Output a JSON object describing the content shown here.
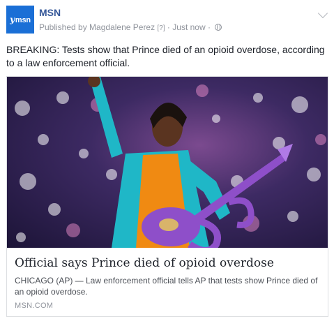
{
  "page": {
    "name": "MSN",
    "logo_text": "msn",
    "logo_mark": "y"
  },
  "meta": {
    "published_by": "Published by Magdalene Perez",
    "help": "[?]",
    "separator": "·",
    "time": "Just now",
    "separator2": "·"
  },
  "post": {
    "text": "BREAKING: Tests show that Prince died of an opioid overdose, according to a law enforcement official."
  },
  "link": {
    "title": "Official says Prince died of opioid overdose",
    "description": "CHICAGO (AP) — Law enforcement official tells AP that tests show Prince died of an opioid overdose.",
    "domain": "MSN.COM"
  },
  "colors": {
    "brand": "#1a6fd6",
    "page_name": "#365899",
    "guitar": "#8e4fc9",
    "shirt": "#f08a12",
    "jacket": "#1fb7c7"
  },
  "icons": [
    "globe-icon",
    "chevron-down-icon"
  ]
}
